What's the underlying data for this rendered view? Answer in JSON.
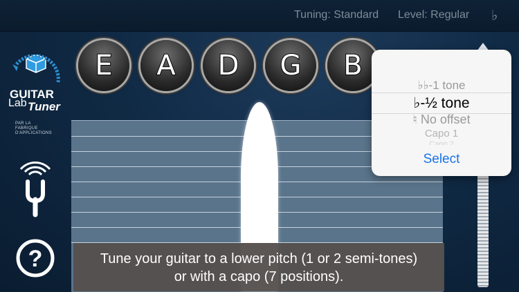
{
  "topbar": {
    "tuning_label": "Tuning: Standard",
    "level_label": "Level: Regular",
    "offset_icon": "♭"
  },
  "logo": {
    "line1": "GUITAR",
    "line2": "Lab",
    "line3": "Tuner",
    "tagline1": "PAR LA",
    "tagline2": "FABRIQUE",
    "tagline3": "D'APPLICATIONS"
  },
  "strings": [
    "E",
    "A",
    "D",
    "G",
    "B"
  ],
  "picker": {
    "items": [
      "♭♭-1 tone",
      "♭-½ tone",
      "♮ No offset",
      "Capo 1",
      "Capo 2"
    ],
    "selected_index": 1,
    "select_label": "Select"
  },
  "banner": {
    "line1": "Tune your guitar to a lower pitch (1 or 2 semi-tones)",
    "line2": "or with a capo (7 positions)."
  },
  "icons": {
    "tuning_fork": "tuning-fork-icon",
    "help": "help-icon"
  }
}
